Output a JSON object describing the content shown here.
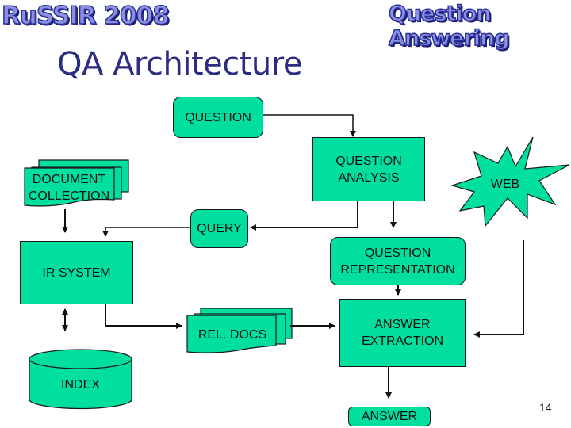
{
  "header": {
    "logo_left": "RuSSIR 2008",
    "logo_right": "Question Answering"
  },
  "slide": {
    "title": "QA Architecture",
    "page_number": "14"
  },
  "colors": {
    "node_fill": "#00df9e",
    "title_color": "#2b2d80",
    "stroke": "#1a1a1a"
  },
  "nodes": {
    "question": "QUESTION",
    "question_analysis_1": "QUESTION",
    "question_analysis_2": "ANALYSIS",
    "web": "WEB",
    "document_collection_1": "DOCUMENT",
    "document_collection_2": "COLLECTION",
    "query": "QUERY",
    "ir_system": "IR SYSTEM",
    "question_representation_1": "QUESTION",
    "question_representation_2": "REPRESENTATION",
    "rel_docs": "REL. DOCS",
    "answer_extraction_1": "ANSWER",
    "answer_extraction_2": "EXTRACTION",
    "index": "INDEX",
    "answer": "ANSWER"
  }
}
